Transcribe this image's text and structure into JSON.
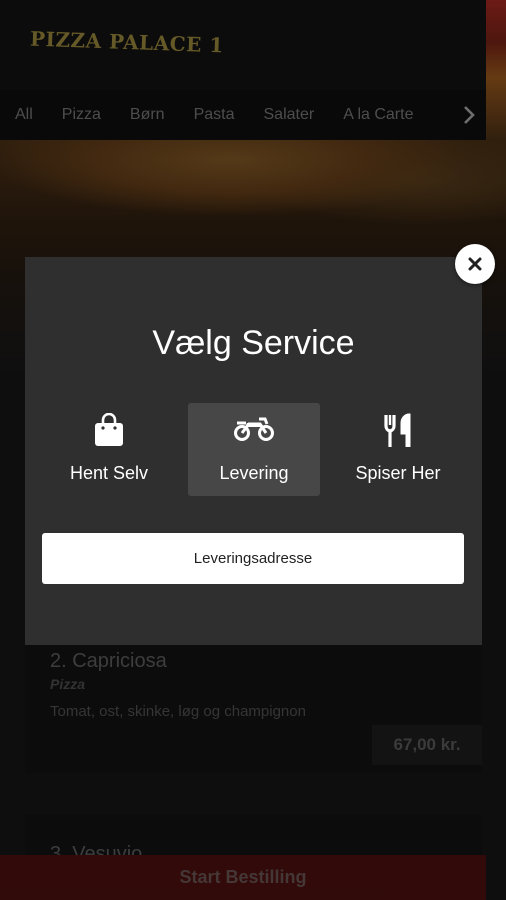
{
  "app": {
    "logo_text": "PIZZA PALACE 1"
  },
  "categories": [
    "All",
    "Pizza",
    "Børn",
    "Pasta",
    "Salater",
    "A la Carte"
  ],
  "menu_items": [
    {
      "title": "2. Capriciosa",
      "category": "Pizza",
      "description": "Tomat, ost, skinke, løg og champignon",
      "price": "67,00 kr."
    },
    {
      "title": "3. Vesuvio"
    }
  ],
  "start_button": "Start Bestilling",
  "modal": {
    "title": "Vælg Service",
    "options": [
      {
        "label": "Hent Selv",
        "icon": "shopping-bag-icon",
        "selected": false
      },
      {
        "label": "Levering",
        "icon": "motorcycle-icon",
        "selected": true
      },
      {
        "label": "Spiser Her",
        "icon": "fork-knife-icon",
        "selected": false
      }
    ],
    "address_button": "Leveringsadresse"
  },
  "colors": {
    "modal_bg": "#2f2f2f",
    "selected_option_bg": "#474747",
    "start_bar": "#8b1c1a",
    "logo": "#b9a24a"
  }
}
